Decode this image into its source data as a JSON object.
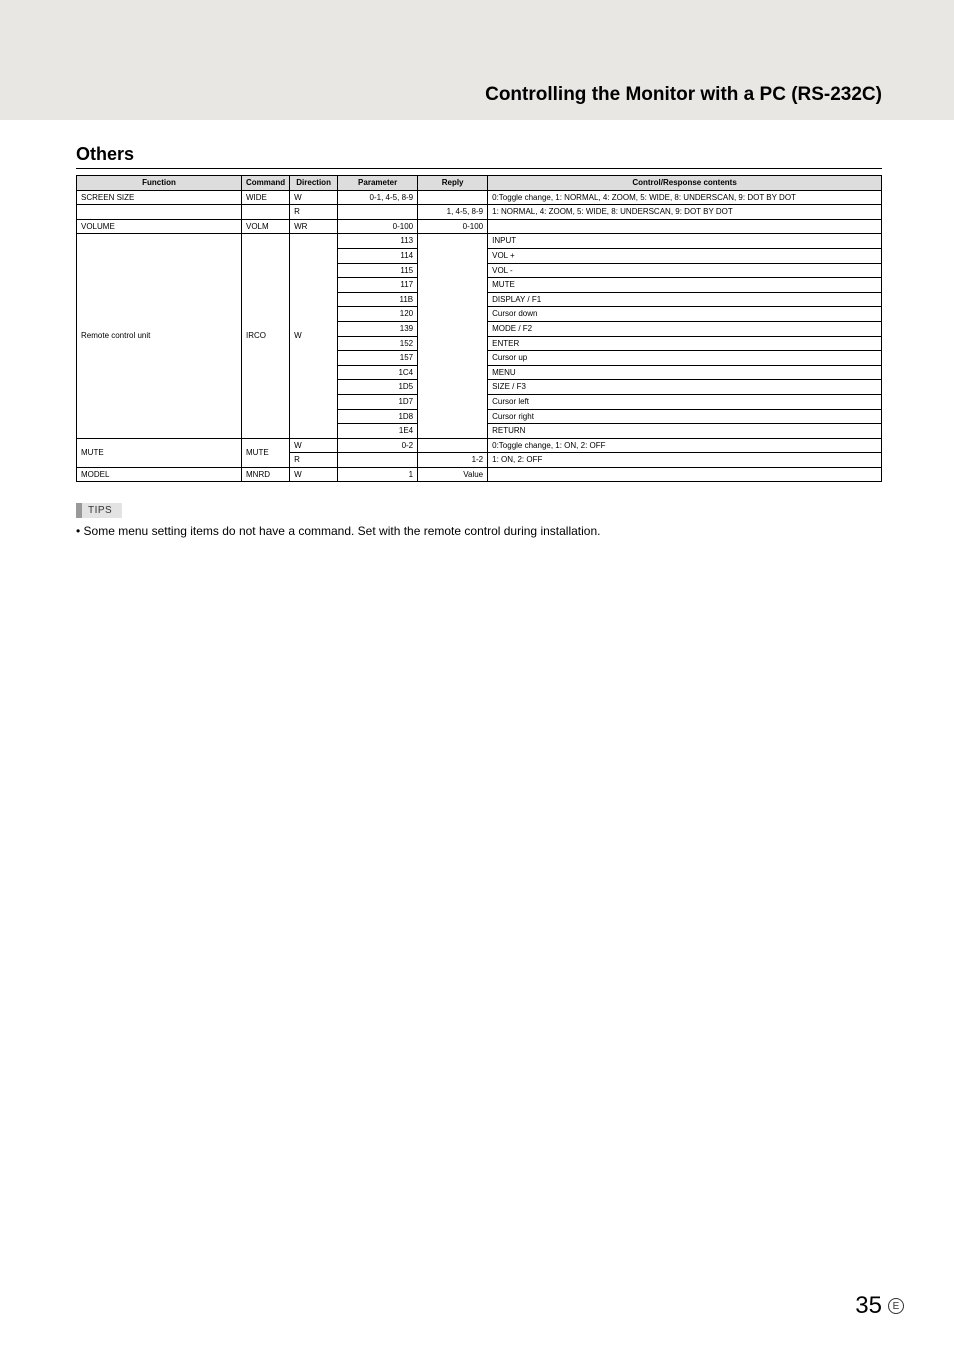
{
  "header": {
    "title": "Controlling the Monitor with a PC (RS-232C)"
  },
  "section": {
    "title": "Others"
  },
  "columns": [
    "Function",
    "Command",
    "Direction",
    "Parameter",
    "Reply",
    "Control/Response contents"
  ],
  "groups": [
    {
      "func": "SCREEN SIZE",
      "funcRowspan": 1,
      "cmd": "WIDE",
      "cmdRowspan": 1,
      "rows": [
        {
          "dir": "W",
          "param": "0-1, 4-5, 8-9",
          "reply": "",
          "contents": "0:Toggle change, 1: NORMAL, 4: ZOOM, 5: WIDE, 8: UNDERSCAN, 9: DOT BY DOT"
        }
      ]
    },
    {
      "rows": [
        {
          "dir": "R",
          "param": "",
          "reply": "1, 4-5, 8-9",
          "contents": "1: NORMAL, 4: ZOOM, 5: WIDE, 8: UNDERSCAN, 9: DOT BY DOT"
        }
      ]
    },
    {
      "func": "VOLUME",
      "funcRowspan": 1,
      "cmd": "VOLM",
      "cmdRowspan": 1,
      "rows": [
        {
          "dir": "WR",
          "param": "0-100",
          "reply": "0-100",
          "contents": ""
        }
      ]
    },
    {
      "func": "Remote control unit",
      "funcRowspan": 14,
      "cmd": "IRCO",
      "cmdRowspan": 14,
      "rows": [
        {
          "dir": "W",
          "dirRowspan": 14,
          "param": "113",
          "reply": "",
          "replyRowspan": 14,
          "contents": "INPUT"
        },
        {
          "param": "114",
          "contents": "VOL +"
        },
        {
          "param": "115",
          "contents": "VOL -"
        },
        {
          "param": "117",
          "contents": "MUTE"
        },
        {
          "param": "11B",
          "contents": "DISPLAY / F1"
        },
        {
          "param": "120",
          "contents": "Cursor down"
        },
        {
          "param": "139",
          "contents": "MODE / F2"
        },
        {
          "param": "152",
          "contents": "ENTER"
        },
        {
          "param": "157",
          "contents": "Cursor up"
        },
        {
          "param": "1C4",
          "contents": "MENU"
        },
        {
          "param": "1D5",
          "contents": "SIZE / F3"
        },
        {
          "param": "1D7",
          "contents": "Cursor left"
        },
        {
          "param": "1D8",
          "contents": "Cursor right"
        },
        {
          "param": "1E4",
          "contents": "RETURN"
        }
      ]
    },
    {
      "func": "MUTE",
      "funcRowspan": 2,
      "cmd": "MUTE",
      "cmdRowspan": 2,
      "rows": [
        {
          "dir": "W",
          "param": "0-2",
          "reply": "",
          "contents": "0:Toggle change, 1: ON, 2: OFF"
        },
        {
          "dir": "R",
          "param": "",
          "reply": "1-2",
          "contents": "1: ON, 2: OFF"
        }
      ]
    },
    {
      "func": "MODEL",
      "funcRowspan": 1,
      "cmd": "MNRD",
      "cmdRowspan": 1,
      "rows": [
        {
          "dir": "W",
          "param": "1",
          "reply": "Value",
          "contents": ""
        }
      ]
    }
  ],
  "tips": {
    "label": "TIPS",
    "text": "•  Some menu setting items do not have a command. Set with the remote control during installation."
  },
  "page": {
    "num": "35",
    "suffix": "E"
  }
}
